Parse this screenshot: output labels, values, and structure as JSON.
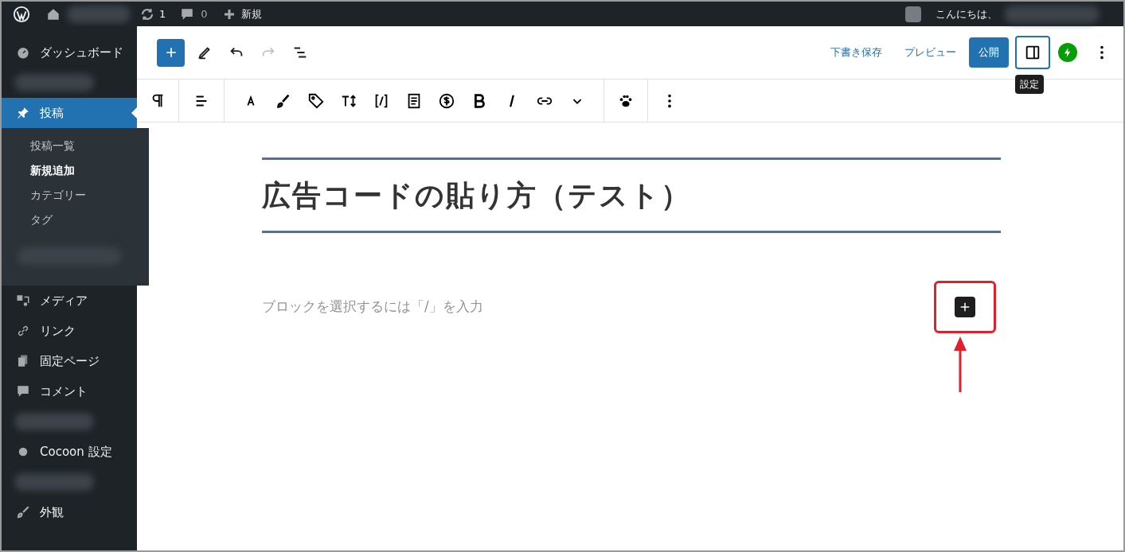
{
  "admin_bar": {
    "updates": "1",
    "comments": "0",
    "new": "新規",
    "greeting": "こんにちは、"
  },
  "sidebar": {
    "items": [
      {
        "kind": "item",
        "label": "ダッシュボード",
        "selected": false
      },
      {
        "kind": "blurred"
      },
      {
        "kind": "item",
        "label": "投稿",
        "selected": true,
        "children": [
          {
            "kind": "item",
            "label": "投稿一覧",
            "selected": false
          },
          {
            "kind": "item",
            "label": "新規追加",
            "selected": true
          },
          {
            "kind": "item",
            "label": "カテゴリー",
            "selected": false
          },
          {
            "kind": "item",
            "label": "タグ",
            "selected": false
          },
          {
            "kind": "blurred"
          }
        ]
      },
      {
        "kind": "item",
        "label": "メディア",
        "selected": false
      },
      {
        "kind": "item",
        "label": "リンク",
        "selected": false
      },
      {
        "kind": "item",
        "label": "固定ページ",
        "selected": false
      },
      {
        "kind": "item",
        "label": "コメント",
        "selected": false
      },
      {
        "kind": "blurred"
      },
      {
        "kind": "item",
        "label": "Cocoon 設定",
        "selected": false
      },
      {
        "kind": "blurred"
      },
      {
        "kind": "item",
        "label": "外観",
        "selected": false
      }
    ]
  },
  "editor_header": {
    "tools": [
      {
        "kind": "edit",
        "disabled": false
      },
      {
        "kind": "undo",
        "disabled": false
      },
      {
        "kind": "redo",
        "disabled": true
      },
      {
        "kind": "outline",
        "disabled": false
      }
    ],
    "save_draft": "下書き保存",
    "preview": "プレビュー",
    "publish": "公開",
    "settings": {
      "selected": true,
      "tooltip": "設定"
    }
  },
  "post": {
    "title": "広告コードの貼り方（テスト）",
    "block_placeholder": "ブロックを選択するには「/」を入力"
  }
}
